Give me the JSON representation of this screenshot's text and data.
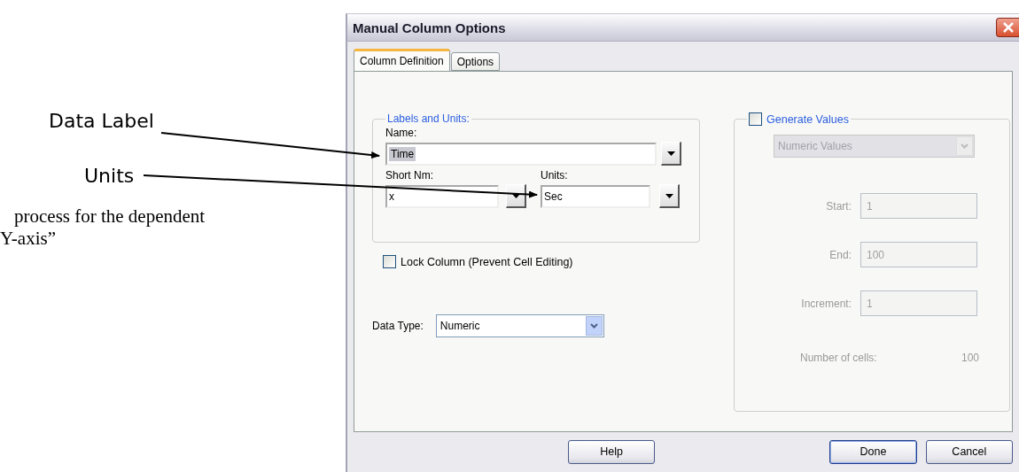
{
  "annotations": [
    {
      "text": "Data Label"
    },
    {
      "text": "Units"
    }
  ],
  "note_lines": [
    "process for the dependent",
    "Y-axis”"
  ],
  "dialog": {
    "title": "Manual Column Options",
    "tabs": [
      {
        "label": "Column Definition",
        "selected": true
      },
      {
        "label": "Options",
        "selected": false
      }
    ],
    "labels_group": {
      "title": "Labels and Units:",
      "name": {
        "label": "Name:",
        "value": "Time",
        "highlighted": true
      },
      "short_name": {
        "label": "Short Nm:",
        "value": "x"
      },
      "units": {
        "label": "Units:",
        "value": "Sec"
      }
    },
    "lock_column": {
      "label": "Lock Column (Prevent Cell Editing)",
      "checked": false
    },
    "data_type": {
      "label": "Data Type:",
      "value": "Numeric"
    },
    "generate": {
      "label": "Generate Values",
      "checked": false,
      "mode": "Numeric Values",
      "fields": [
        {
          "label": "Start:",
          "value": "1"
        },
        {
          "label": "End:",
          "value": "100"
        },
        {
          "label": "Increment:",
          "value": "1"
        }
      ],
      "count_label": "Number of cells:",
      "count": "100"
    },
    "buttons": [
      {
        "label": "Help",
        "default": false
      },
      {
        "label": "Done",
        "default": true
      },
      {
        "label": "Cancel",
        "default": false
      }
    ]
  }
}
